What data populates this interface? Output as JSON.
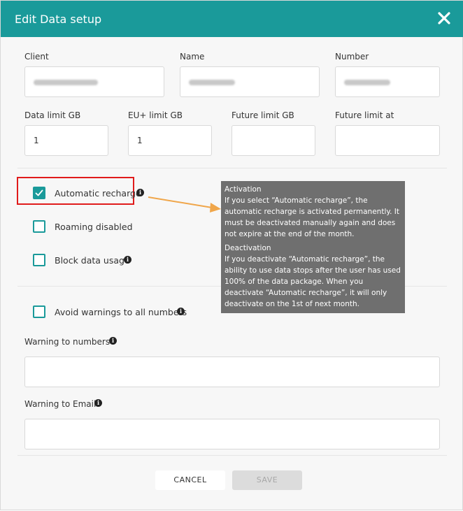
{
  "dialog": {
    "title": "Edit Data setup",
    "close_icon": "close-icon",
    "header_color": "#1a9a9a"
  },
  "fields": {
    "client": {
      "label": "Client",
      "value": ""
    },
    "name": {
      "label": "Name",
      "value": ""
    },
    "number": {
      "label": "Number",
      "value": ""
    },
    "data_limit": {
      "label": "Data limit GB",
      "value": "1"
    },
    "eu_limit": {
      "label": "EU+ limit GB",
      "value": "1"
    },
    "future_limit": {
      "label": "Future limit GB",
      "value": ""
    },
    "future_limit_at": {
      "label": "Future limit at",
      "value": ""
    }
  },
  "options": {
    "automatic_recharge": {
      "label": "Automatic recharge",
      "checked": true
    },
    "roaming_disabled": {
      "label": "Roaming disabled",
      "checked": false
    },
    "block_data_usage": {
      "label": "Block data usage",
      "checked": false
    },
    "avoid_warnings": {
      "label": "Avoid warnings to all numbers",
      "checked": false
    }
  },
  "warnings": {
    "numbers": {
      "label": "Warning to numbers",
      "value": ""
    },
    "email": {
      "label": "Warning to Email",
      "value": ""
    }
  },
  "tooltip": {
    "activation_title": "Activation",
    "activation_text": "If you select “Automatic recharge”, the automatic recharge is activated permanently. It must be deactivated manually again and does not expire at the end of the month.",
    "deactivation_title": "Deactivation",
    "deactivation_text": "If you deactivate “Automatic recharge”, the ability to use data stops after the user has used 100% of the data package. When you deactivate “Automatic recharge”, it will only deactivate on the 1st of next month."
  },
  "buttons": {
    "cancel": "CANCEL",
    "save": "SAVE"
  }
}
